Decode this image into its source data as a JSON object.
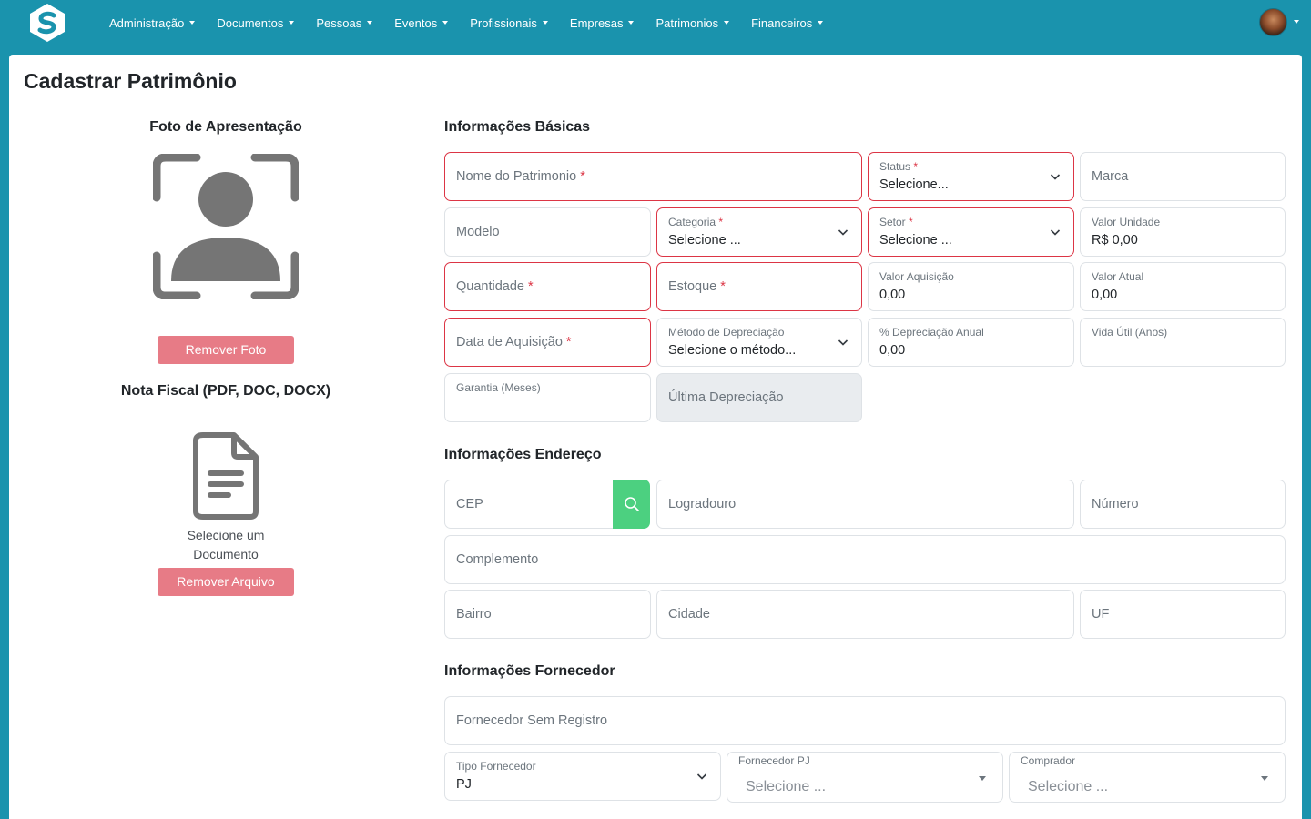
{
  "nav": {
    "items": [
      {
        "label": "Administração"
      },
      {
        "label": "Documentos"
      },
      {
        "label": "Pessoas"
      },
      {
        "label": "Eventos"
      },
      {
        "label": "Profissionais"
      },
      {
        "label": "Empresas"
      },
      {
        "label": "Patrimonios"
      },
      {
        "label": "Financeiros"
      }
    ],
    "logo_icon": "s-logo-icon",
    "avatar_icon": "user-avatar"
  },
  "page": {
    "title": "Cadastrar Patrimônio"
  },
  "left": {
    "photo_heading": "Foto de Apresentação",
    "remove_photo_label": "Remover Foto",
    "invoice_heading": "Nota Fiscal (PDF, DOC, DOCX)",
    "select_document_text": "Selecione um Documento",
    "remove_file_label": "Remover Arquivo"
  },
  "basic": {
    "heading": "Informações Básicas",
    "nome_patrimonio": {
      "placeholder": "Nome do Patrimonio",
      "required": "*"
    },
    "status": {
      "label": "Status",
      "required": "*",
      "value": "Selecione..."
    },
    "marca": {
      "placeholder": "Marca"
    },
    "modelo": {
      "placeholder": "Modelo"
    },
    "categoria": {
      "label": "Categoria",
      "required": "*",
      "value": "Selecione ..."
    },
    "setor": {
      "label": "Setor",
      "required": "*",
      "value": "Selecione ..."
    },
    "valor_unidade": {
      "label": "Valor Unidade",
      "value": "R$ 0,00"
    },
    "quantidade": {
      "placeholder": "Quantidade",
      "required": "*"
    },
    "estoque": {
      "placeholder": "Estoque",
      "required": "*"
    },
    "valor_aquisicao": {
      "label": "Valor Aquisição",
      "value": "0,00"
    },
    "valor_atual": {
      "label": "Valor Atual",
      "value": "0,00"
    },
    "data_aquisicao": {
      "placeholder": "Data de Aquisição",
      "required": "*"
    },
    "metodo_depreciacao": {
      "label": "Método de Depreciação",
      "value": "Selecione o método..."
    },
    "depreciacao_anual": {
      "label": "% Depreciação Anual",
      "value": "0,00"
    },
    "vida_util": {
      "label": "Vida Útil (Anos)"
    },
    "garantia": {
      "label": "Garantia (Meses)"
    },
    "ultima_depreciacao": {
      "placeholder": "Última Depreciação"
    }
  },
  "address": {
    "heading": "Informações Endereço",
    "cep": {
      "placeholder": "CEP"
    },
    "logradouro": {
      "placeholder": "Logradouro"
    },
    "numero": {
      "placeholder": "Número"
    },
    "complemento": {
      "placeholder": "Complemento"
    },
    "bairro": {
      "placeholder": "Bairro"
    },
    "cidade": {
      "placeholder": "Cidade"
    },
    "uf": {
      "placeholder": "UF"
    }
  },
  "supplier": {
    "heading": "Informações Fornecedor",
    "fornecedor_sem_registro": {
      "placeholder": "Fornecedor Sem Registro"
    },
    "tipo_fornecedor": {
      "label": "Tipo Fornecedor",
      "value": "PJ"
    },
    "fornecedor_pj": {
      "label": "Fornecedor PJ",
      "placeholder": "Selecione ..."
    },
    "comprador": {
      "label": "Comprador",
      "placeholder": "Selecione ..."
    }
  },
  "colors": {
    "navbar": "#1a93ad",
    "required_border": "#dc3545",
    "danger_button": "#e77b86",
    "search_button": "#4cd080"
  }
}
